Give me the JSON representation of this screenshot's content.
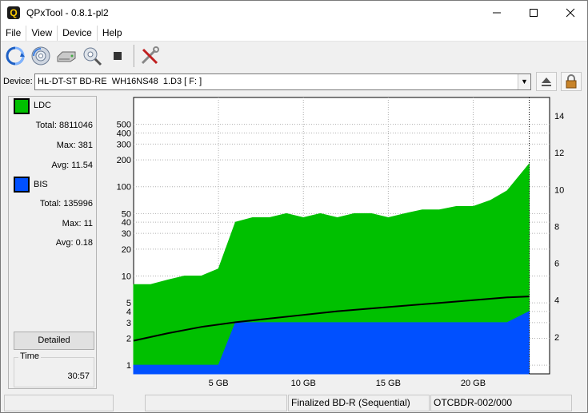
{
  "window": {
    "title": "QPxTool - 0.8.1-pl2",
    "icon": "Q"
  },
  "menu": [
    "File",
    "View",
    "Device",
    "Help"
  ],
  "toolbar": [
    "refresh-icon",
    "disc-icon",
    "drive-icon",
    "search-disc-icon",
    "stop-icon",
    "tools-icon"
  ],
  "device": {
    "label": "Device:",
    "selected": "HL-DT-ST BD-RE  WH16NS48  1.D3 [ F: ]"
  },
  "legend": {
    "ldc": {
      "name": "LDC",
      "color": "#00c000",
      "total_label": "Total:",
      "total": "8811046",
      "max_label": "Max:",
      "max": "381",
      "avg_label": "Avg:",
      "avg": "11.54"
    },
    "bis": {
      "name": "BIS",
      "color": "#0050ff",
      "total_label": "Total:",
      "total": "135996",
      "max_label": "Max:",
      "max": "11",
      "avg_label": "Avg:",
      "avg": "0.18"
    }
  },
  "detailed_label": "Detailed",
  "time": {
    "label": "Time",
    "value": "30:57"
  },
  "status": {
    "cell1": "",
    "cell2": "",
    "disc_type": "Finalized BD-R (Sequential)",
    "media_id": "OTCBDR-002/000"
  },
  "chart_data": {
    "type": "area",
    "x_tick_labels": [
      "5 GB",
      "10 GB",
      "15 GB",
      "20 GB"
    ],
    "x_ticks_gb": [
      5,
      10,
      15,
      20
    ],
    "xlim_gb": [
      0,
      24.5
    ],
    "data_end_gb": 23.3,
    "y_left_scale": "log",
    "y_left_ticks": [
      1,
      2,
      3,
      4,
      5,
      10,
      20,
      30,
      40,
      50,
      100,
      200,
      300,
      400,
      500
    ],
    "ylim_left": [
      0.8,
      1000
    ],
    "y_right_ticks": [
      2,
      4,
      6,
      8,
      10,
      12,
      14
    ],
    "ylim_right": [
      0,
      15
    ],
    "grid": true,
    "series": [
      {
        "name": "LDC",
        "color": "#00c000",
        "x": [
          0,
          1,
          2,
          3,
          4,
          5,
          6,
          7,
          8,
          9,
          10,
          11,
          12,
          13,
          14,
          15,
          16,
          17,
          18,
          19,
          20,
          21,
          22,
          23.3
        ],
        "values": [
          8,
          8,
          9,
          10,
          10,
          12,
          40,
          45,
          45,
          50,
          45,
          50,
          45,
          50,
          50,
          45,
          50,
          55,
          55,
          60,
          60,
          70,
          90,
          180
        ]
      },
      {
        "name": "BIS",
        "color": "#0050ff",
        "x": [
          0,
          1,
          2,
          3,
          4,
          5,
          6,
          7,
          8,
          9,
          10,
          11,
          12,
          13,
          14,
          15,
          16,
          17,
          18,
          19,
          20,
          21,
          22,
          23.3
        ],
        "values": [
          1,
          1,
          1,
          1,
          1,
          1,
          3,
          3,
          3,
          3,
          3,
          3,
          3,
          3,
          3,
          3,
          3,
          3,
          3,
          3,
          3,
          3,
          3,
          4
        ]
      },
      {
        "name": "Speed",
        "color": "#000000",
        "axis": "right",
        "x": [
          0,
          2,
          4,
          6,
          8,
          10,
          12,
          14,
          16,
          18,
          20,
          22,
          23.3
        ],
        "values": [
          1.8,
          2.2,
          2.55,
          2.8,
          3.0,
          3.2,
          3.4,
          3.55,
          3.7,
          3.85,
          4.0,
          4.15,
          4.2
        ]
      }
    ]
  }
}
